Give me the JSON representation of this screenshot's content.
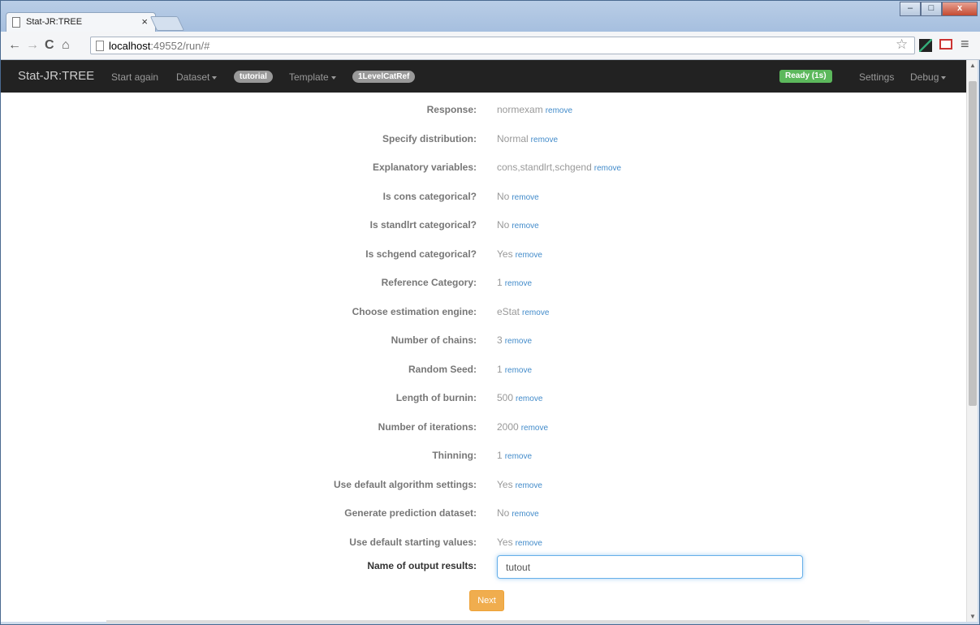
{
  "browser": {
    "tab_title": "Stat-JR:TREE",
    "tab_close": "×",
    "url_host": "localhost",
    "url_rest": ":49552/run/#",
    "win_min": "–",
    "win_max": "□",
    "win_close": "x"
  },
  "toolbar": {
    "back": "←",
    "forward": "→",
    "reload": "C",
    "home": "⌂",
    "star": "☆",
    "menu": "≡"
  },
  "navbar": {
    "brand": "Stat-JR:TREE",
    "start_again": "Start again",
    "dataset": "Dataset",
    "dataset_value": "tutorial",
    "template": "Template",
    "template_value": "1LevelCatRef",
    "status": "Ready (1s)",
    "settings": "Settings",
    "debug": "Debug"
  },
  "remove_label": "remove",
  "fields": [
    {
      "label": "Response:",
      "value": "normexam"
    },
    {
      "label": "Specify distribution:",
      "value": "Normal"
    },
    {
      "label": "Explanatory variables:",
      "value": "cons,standlrt,schgend"
    },
    {
      "label": "Is cons categorical?",
      "value": "No"
    },
    {
      "label": "Is standlrt categorical?",
      "value": "No"
    },
    {
      "label": "Is schgend categorical?",
      "value": "Yes"
    },
    {
      "label": "Reference Category:",
      "value": "1"
    },
    {
      "label": "Choose estimation engine:",
      "value": "eStat"
    },
    {
      "label": "Number of chains:",
      "value": "3"
    },
    {
      "label": "Random Seed:",
      "value": "1"
    },
    {
      "label": "Length of burnin:",
      "value": "500"
    },
    {
      "label": "Number of iterations:",
      "value": "2000"
    },
    {
      "label": "Thinning:",
      "value": "1"
    },
    {
      "label": "Use default algorithm settings:",
      "value": "Yes"
    },
    {
      "label": "Generate prediction dataset:",
      "value": "No"
    },
    {
      "label": "Use default starting values:",
      "value": "Yes"
    }
  ],
  "output": {
    "label": "Name of output results:",
    "value": "tutout"
  },
  "next_label": "Next"
}
